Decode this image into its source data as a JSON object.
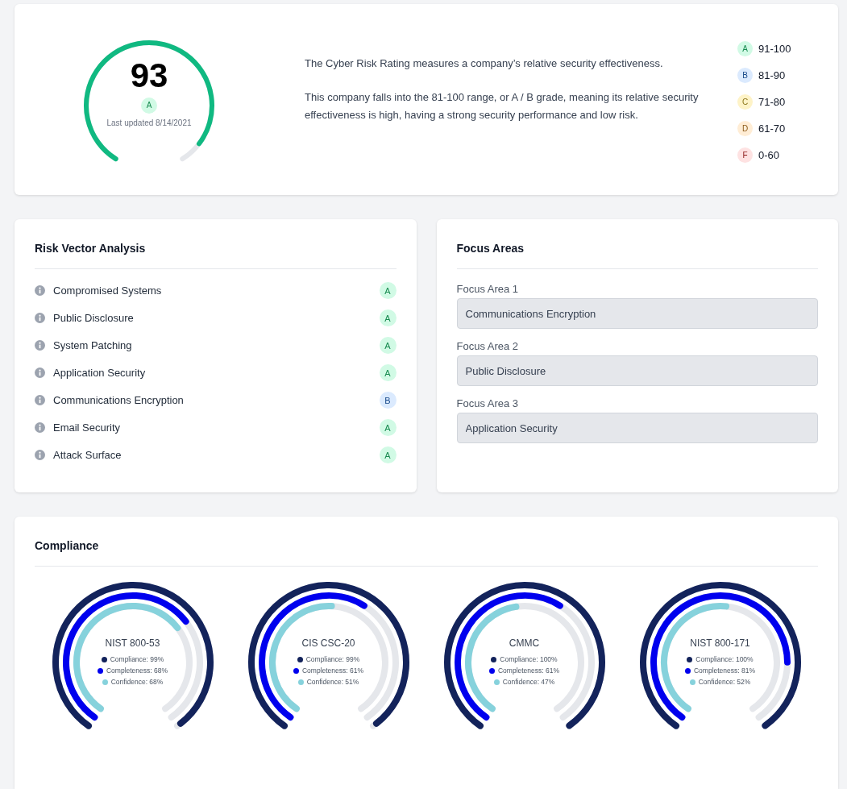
{
  "rating": {
    "score": "93",
    "grade": {
      "letter": "A",
      "color": "#d1fae5"
    },
    "updated": "Last updated 8/14/2021",
    "description": [
      "The Cyber Risk Rating measures a company’s relative security effectiveness.",
      "This company falls into the 81-100 range, or A / B grade, meaning its relative security effectiveness is high, having a strong security performance and low risk."
    ],
    "legend": [
      {
        "letter": "A",
        "range": "91-100",
        "color": "#d1fae5"
      },
      {
        "letter": "B",
        "range": "81-90",
        "color": "#dbeafe"
      },
      {
        "letter": "C",
        "range": "71-80",
        "color": "#fef3c7"
      },
      {
        "letter": "D",
        "range": "61-70",
        "color": "#ffedd5"
      },
      {
        "letter": "F",
        "range": "0-60",
        "color": "#fee2e2"
      }
    ]
  },
  "risk_vectors": {
    "title": "Risk Vector Analysis",
    "items": [
      {
        "name": "Compromised Systems",
        "grade": "A",
        "color": "#d1fae5"
      },
      {
        "name": "Public Disclosure",
        "grade": "A",
        "color": "#d1fae5"
      },
      {
        "name": "System Patching",
        "grade": "A",
        "color": "#d1fae5"
      },
      {
        "name": "Application Security",
        "grade": "A",
        "color": "#d1fae5"
      },
      {
        "name": "Communications Encryption",
        "grade": "B",
        "color": "#dbeafe"
      },
      {
        "name": "Email Security",
        "grade": "A",
        "color": "#d1fae5"
      },
      {
        "name": "Attack Surface",
        "grade": "A",
        "color": "#d1fae5"
      }
    ]
  },
  "focus_areas": {
    "title": "Focus Areas",
    "fields": [
      {
        "label": "Focus Area 1",
        "value": "Communications Encryption"
      },
      {
        "label": "Focus Area 2",
        "value": "Public Disclosure"
      },
      {
        "label": "Focus Area 3",
        "value": "Application Security"
      }
    ]
  },
  "compliance": {
    "title": "Compliance",
    "frameworks": [
      {
        "name": "NIST 800-53",
        "metrics": [
          {
            "label": "Compliance: 99%",
            "color": "#13235b"
          },
          {
            "label": "Completeness: 68%",
            "color": "#0000ee"
          },
          {
            "label": "Confidence: 68%",
            "color": "#86d2dc"
          }
        ]
      },
      {
        "name": "CIS CSC-20",
        "metrics": [
          {
            "label": "Compliance: 99%",
            "color": "#13235b"
          },
          {
            "label": "Completeness: 61%",
            "color": "#0000ee"
          },
          {
            "label": "Confidence: 51%",
            "color": "#86d2dc"
          }
        ]
      },
      {
        "name": "CMMC",
        "metrics": [
          {
            "label": "Compliance: 100%",
            "color": "#13235b"
          },
          {
            "label": "Completeness: 61%",
            "color": "#0000ee"
          },
          {
            "label": "Confidence: 47%",
            "color": "#86d2dc"
          }
        ]
      },
      {
        "name": "NIST 800-171",
        "metrics": [
          {
            "label": "Compliance: 100%",
            "color": "#13235b"
          },
          {
            "label": "Completeness: 81%",
            "color": "#0000ee"
          },
          {
            "label": "Confidence: 52%",
            "color": "#86d2dc"
          }
        ]
      }
    ]
  }
}
